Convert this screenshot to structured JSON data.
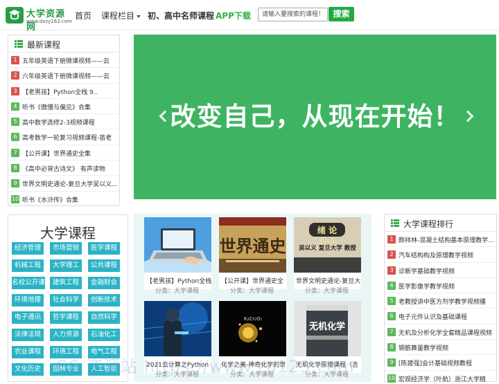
{
  "header": {
    "logo_name": "大学资源网",
    "logo_url": "www.dxzy163.com",
    "nav": [
      "首页",
      "课程栏目",
      "初、高中名师课程",
      "APP下载"
    ],
    "search_placeholder": "请输入要搜索的课程！",
    "search_button": "搜索"
  },
  "latest": {
    "title": "最新课程",
    "items": [
      {
        "n": "1",
        "text": "五年级英语下册微课视频——云"
      },
      {
        "n": "2",
        "text": "六年级英语下册微课视频——云"
      },
      {
        "n": "3",
        "text": "【老男孩】Python全栈 9.."
      },
      {
        "n": "4",
        "text": "听书《傲慢与偏见》合集"
      },
      {
        "n": "5",
        "text": "高中数学选修2-3视频课程"
      },
      {
        "n": "6",
        "text": "高考数学一轮复习视频课程-苗老"
      },
      {
        "n": "7",
        "text": "【公开课】世界通史全集"
      },
      {
        "n": "8",
        "text": "《高中必背古诗文》 有声读物"
      },
      {
        "n": "9",
        "text": "世界文明史通论-复旦大学吴以义..."
      },
      {
        "n": "10",
        "text": "听书《水浒传》合集"
      }
    ]
  },
  "banner": {
    "text": "改变自己，从现在开始！"
  },
  "categories": {
    "title": "大学课程",
    "items": [
      "经济管理",
      "市场营销",
      "医学课程",
      "机械工程",
      "大学理工",
      "公共课程",
      "名校公开课",
      "建筑工程",
      "金融财会",
      "环境地理",
      "社会科学",
      "创新技术",
      "电子通讯",
      "哲学课程",
      "自然科学",
      "法律法规",
      "人力资源",
      "石油化工",
      "农业课程",
      "环境工程",
      "电气工程",
      "文化历史",
      "园林专业",
      "人工智能"
    ]
  },
  "courses": [
    {
      "title": "【老男孩】Python全栈",
      "category": "分类：大学课程"
    },
    {
      "title": "【公开课】世界通史全",
      "category": "分类：大学课程"
    },
    {
      "title": "世界文明史通论-复旦大",
      "category": "分类：大学课程"
    },
    {
      "title": "2021云计算之Python",
      "category": "分类：大学课程"
    },
    {
      "title": "化学之美-神奇化学的世",
      "category": "分类：大学课程"
    },
    {
      "title": "无机化学原理课程（吉",
      "category": "分类：大学课程"
    }
  ],
  "thumbs": {
    "book1_title": "世界通史",
    "book2_tag": "绪 论（一）",
    "book2_sub": "吴以义 复旦大学 教授",
    "book3_title": "无机化学",
    "formula": "K₂Cr₂O₇"
  },
  "ranking": {
    "title": "大学课程排行",
    "items": [
      {
        "n": "1",
        "text": "颜祥林-混凝土结构基本原理教学..."
      },
      {
        "n": "2",
        "text": "汽车结构构及原理教学视频"
      },
      {
        "n": "3",
        "text": "诊断学基础教学视频"
      },
      {
        "n": "4",
        "text": "医学影像学教学视频"
      },
      {
        "n": "5",
        "text": "老教授讲中医方剂学教学视频播"
      },
      {
        "n": "6",
        "text": "电子元件认识及基础课程"
      },
      {
        "n": "7",
        "text": "无机及分析化学全套精品课程视频"
      },
      {
        "n": "8",
        "text": "钢筋算量教学视频"
      },
      {
        "n": "9",
        "text": "[陈建强]会计基础视频教程"
      },
      {
        "n": "10",
        "text": "宏观经济学（叶航）浙江大学精"
      }
    ]
  },
  "watermark": "CC 资源站 https://www.zu123.com",
  "colors": {
    "brand_green": "#2a9d49",
    "banner_green": "#3eb462",
    "category_teal": "#2ab3c6",
    "rank_red": "#d9534f",
    "rank_green": "#5cb85c"
  }
}
